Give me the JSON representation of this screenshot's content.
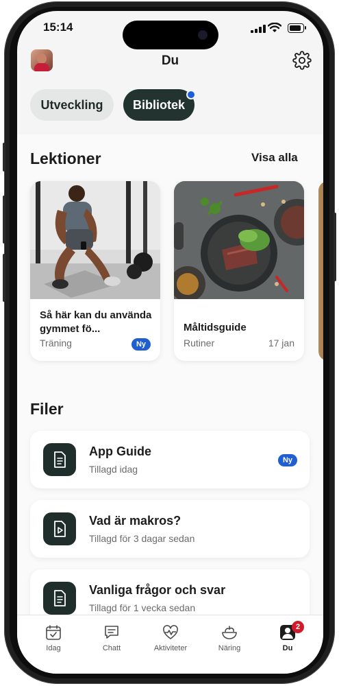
{
  "status_bar": {
    "time": "15:14"
  },
  "header": {
    "title": "Du"
  },
  "segments": {
    "tab1": "Utveckling",
    "tab2": "Bibliotek"
  },
  "lessons": {
    "title": "Lektioner",
    "see_all": "Visa alla",
    "cards": [
      {
        "title": "Så här kan du använda gymmet fö...",
        "category": "Träning",
        "badge": "Ny"
      },
      {
        "title": "Måltidsguide",
        "category": "Rutiner",
        "date": "17 jan"
      }
    ]
  },
  "files": {
    "title": "Filer",
    "items": [
      {
        "title": "App Guide",
        "subtitle": "Tillagd idag",
        "badge": "Ny",
        "icon": "document-icon"
      },
      {
        "title": "Vad är makros?",
        "subtitle": "Tillagd för 3 dagar sedan",
        "icon": "video-file-icon"
      },
      {
        "title": "Vanliga frågor och svar",
        "subtitle": "Tillagd för 1 vecka sedan",
        "icon": "document-icon"
      }
    ]
  },
  "tabbar": {
    "items": [
      {
        "label": "Idag",
        "icon": "calendar-check-icon"
      },
      {
        "label": "Chatt",
        "icon": "chat-icon"
      },
      {
        "label": "Aktiviteter",
        "icon": "heart-pulse-icon"
      },
      {
        "label": "Näring",
        "icon": "food-bowl-icon"
      },
      {
        "label": "Du",
        "icon": "user-icon",
        "badge": "2"
      }
    ]
  },
  "colors": {
    "accent_dark": "#223330",
    "badge_blue": "#1f5fcf",
    "notification_red": "#d11a2a"
  }
}
